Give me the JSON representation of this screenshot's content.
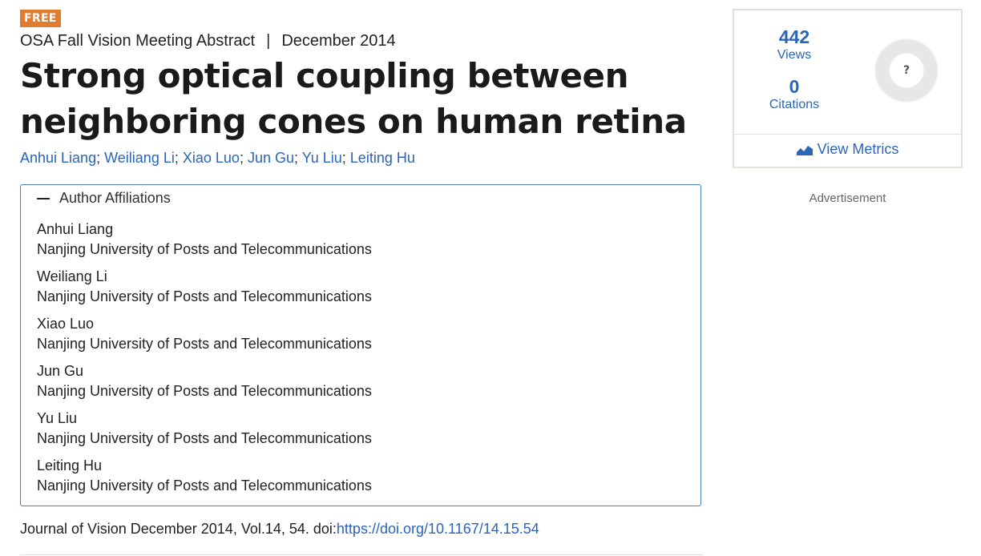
{
  "badge": "FREE",
  "meta": {
    "type": "OSA Fall Vision Meeting Abstract",
    "separator": "|",
    "date": "December 2014"
  },
  "title": "Strong optical coupling between neighboring cones on human retina",
  "authors": [
    "Anhui Liang",
    "Weiliang Li",
    "Xiao Luo",
    "Jun Gu",
    "Yu Liu",
    "Leiting Hu"
  ],
  "author_separator": ";",
  "affiliations": {
    "header": "Author Affiliations",
    "items": [
      {
        "name": "Anhui Liang",
        "org": "Nanjing University of Posts and Telecommunications"
      },
      {
        "name": "Weiliang Li",
        "org": "Nanjing University of Posts and Telecommunications"
      },
      {
        "name": "Xiao Luo",
        "org": "Nanjing University of Posts and Telecommunications"
      },
      {
        "name": "Jun Gu",
        "org": "Nanjing University of Posts and Telecommunications"
      },
      {
        "name": "Yu Liu",
        "org": "Nanjing University of Posts and Telecommunications"
      },
      {
        "name": "Leiting Hu",
        "org": "Nanjing University of Posts and Telecommunications"
      }
    ]
  },
  "citation": {
    "text": "Journal of Vision December 2014, Vol.14, 54. doi:",
    "doi": "https://doi.org/10.1167/14.15.54"
  },
  "metrics": {
    "views_value": "442",
    "views_label": "Views",
    "citations_value": "0",
    "citations_label": "Citations",
    "altmetric_score": "?",
    "view_metrics_label": "View Metrics"
  },
  "advertisement_label": "Advertisement",
  "colors": {
    "accent": "#2a65b7",
    "badge": "#e07b30",
    "box_border": "#4a7fc1"
  },
  "icons": {
    "collapse": "minus-icon",
    "metrics": "area-chart-icon"
  }
}
